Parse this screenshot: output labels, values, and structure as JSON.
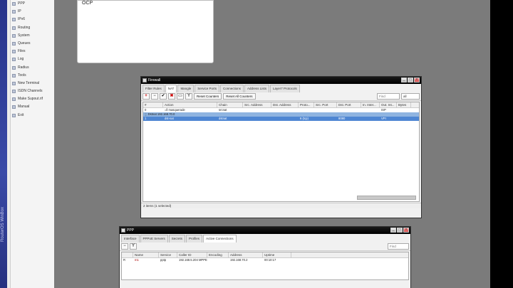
{
  "sidebar": {
    "brand": "RouterOS WinBox",
    "items": [
      "PPP",
      "IP",
      "IPv6",
      "Routing",
      "System",
      "Queues",
      "Files",
      "Log",
      "Radius",
      "Tools",
      "New Terminal",
      "ISDN Channels",
      "Make Supout.rif",
      "Manual",
      "Exit"
    ]
  },
  "top_popup": {
    "item": "OCP"
  },
  "firewall": {
    "title": "Firewall",
    "tabs": [
      "Filter Rules",
      "NAT",
      "Mangle",
      "Service Ports",
      "Connections",
      "Address Lists",
      "Layer7 Protocols"
    ],
    "active_tab": "NAT",
    "buttons": {
      "reset_counters": "Reset Counters",
      "reset_all_counters": "Reset All Counters"
    },
    "filter_placeholder": "Find",
    "filter_value": "all",
    "columns": [
      "#",
      "Action",
      "Chain",
      "Src. Address",
      "Dst. Address",
      "Proto...",
      "Src. Port",
      "Dst. Port",
      "In. Inter...",
      "Out. Int...",
      "Bytes"
    ],
    "rows": [
      {
        "type": "normal",
        "cells": [
          "0",
          "=ll masquerade",
          "srcnat",
          "",
          "",
          "",
          "",
          "",
          "",
          "ISP",
          ""
        ]
      },
      {
        "type": "comment",
        "cells": [
          ";;; Dstnat 192.168.70.0",
          "",
          "",
          "",
          "",
          "",
          "",
          "",
          "",
          "",
          ""
        ]
      },
      {
        "type": "selected",
        "cells": [
          "1",
          "dst-nat",
          "dstnat",
          "",
          "",
          "6 (tcp)",
          "",
          "8080",
          "",
          "VPI",
          ""
        ]
      }
    ],
    "status": "2 items (1 selected)"
  },
  "ppp": {
    "title": "PPP",
    "tabs": [
      "Interface",
      "PPPoE Servers",
      "Secrets",
      "Profiles",
      "Active Connections"
    ],
    "active_tab": "Active Connections",
    "filter_placeholder": "Find",
    "columns": [
      "",
      "Name",
      "Service",
      "Caller ID",
      "Encoding",
      "Address",
      "Uptime"
    ],
    "rows": [
      {
        "cells": [
          "R",
          "m1",
          "pptp",
          "192.168.5.204 MPPE",
          "",
          "192.168.70.2",
          "00:10:17"
        ]
      }
    ]
  }
}
